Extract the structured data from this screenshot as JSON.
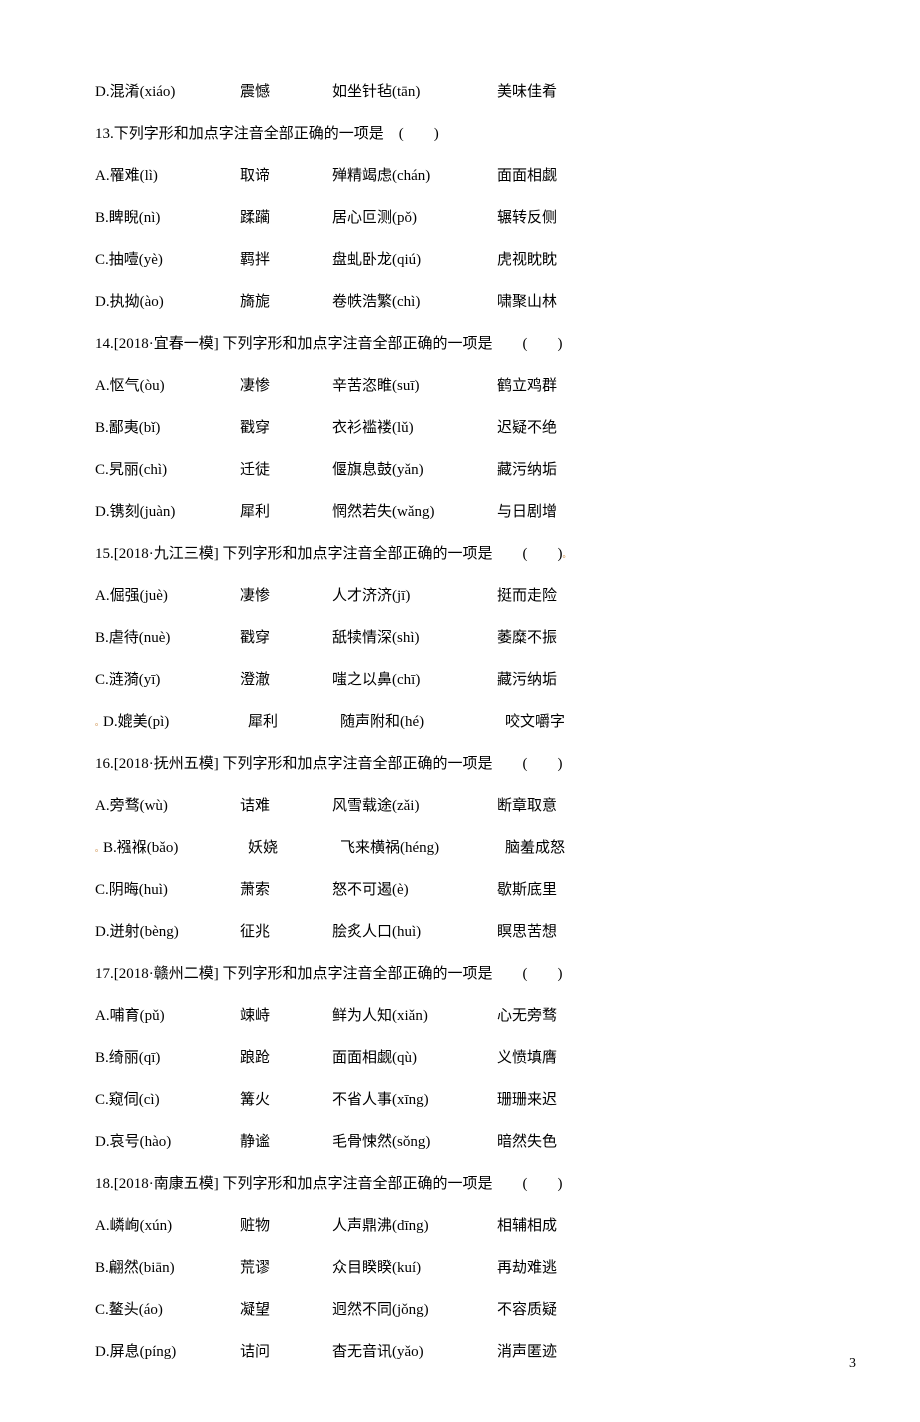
{
  "rows": [
    {
      "type": "opt",
      "a": "D.混淆(xiáo)",
      "b": "震憾",
      "c": "如坐针毡(tān)",
      "d": "美味佳肴"
    },
    {
      "type": "q",
      "text": "13.下列字形和加点字注音全部正确的一项是　(　　)"
    },
    {
      "type": "opt",
      "a": "A.罹难(lì)",
      "b": "取谛",
      "c": "殚精竭虑(chán)",
      "d": "面面相觑"
    },
    {
      "type": "opt",
      "a": "B.睥睨(nì)",
      "b": "蹂躏",
      "c": "居心叵测(pǒ)",
      "d": "辗转反侧"
    },
    {
      "type": "opt",
      "a": "C.抽噎(yè)",
      "b": "羁拌",
      "c": "盘虬卧龙(qiú)",
      "d": "虎视眈眈"
    },
    {
      "type": "opt",
      "a": "D.执拗(ào)",
      "b": "旖旎",
      "c": "卷帙浩繁(chì)",
      "d": "啸聚山林"
    },
    {
      "type": "q",
      "text": "14.[2018·宜春一模] 下列字形和加点字注音全部正确的一项是　　(　　)"
    },
    {
      "type": "opt",
      "a": "A.怄气(òu)",
      "b": "凄惨",
      "c": "辛苦恣睢(suī)",
      "d": "鹤立鸡群"
    },
    {
      "type": "opt",
      "a": "B.鄙夷(bǐ)",
      "b": "戳穿",
      "c": "衣衫褴褛(lǔ)",
      "d": "迟疑不绝"
    },
    {
      "type": "opt",
      "a": "C.旯丽(chì)",
      "b": "迁徒",
      "c": "偃旗息鼓(yǎn)",
      "d": "藏污纳垢",
      "orange_in_c": true
    },
    {
      "type": "opt",
      "a": "D.镌刻(juàn)",
      "b": "犀利",
      "c": "惘然若失(wǎng)",
      "d": "与日剧增"
    },
    {
      "type": "q",
      "text": "15.[2018·九江三模] 下列字形和加点字注音全部正确的一项是　　(　　)",
      "orange_after": true
    },
    {
      "type": "opt",
      "a": "A.倔强(juè)",
      "b": "凄惨",
      "c": "人才济济(jī)",
      "d": "挺而走险"
    },
    {
      "type": "opt",
      "a": "B.虐待(nuè)",
      "b": "戳穿",
      "c": "舐犊情深(shì)",
      "d": "萎糜不振"
    },
    {
      "type": "opt",
      "a": "C.涟漪(yī)",
      "b": "澄澈",
      "c": "嗤之以鼻(chī)",
      "d": "藏污纳垢"
    },
    {
      "type": "opt",
      "a": "D.媲美(pì)",
      "b": "犀利",
      "c": "随声附和(hé)",
      "d": "咬文嚼字",
      "orange_before_a": true
    },
    {
      "type": "q",
      "text": "16.[2018·抚州五模] 下列字形和加点字注音全部正确的一项是　　(　　)"
    },
    {
      "type": "opt",
      "a": "A.旁骛(wù)",
      "b": "诘难",
      "c": "风雪载途(zǎi)",
      "d": "断章取意"
    },
    {
      "type": "opt",
      "a": "B.襁褓(bǎo)",
      "b": "妖娆",
      "c": "飞来横祸(héng)",
      "d": "脑羞成怒",
      "orange_before_a": true
    },
    {
      "type": "opt",
      "a": "C.阴晦(huì)",
      "b": "萧索",
      "c": "怒不可遏(è)",
      "d": "歇斯底里"
    },
    {
      "type": "opt",
      "a": "D.迸射(bèng)",
      "b": "征兆",
      "c": "脍炙人口(huì)",
      "d": "瞑思苦想"
    },
    {
      "type": "q",
      "text": "17.[2018·赣州二模] 下列字形和加点字注音全部正确的一项是　　(　　)"
    },
    {
      "type": "opt",
      "a": "A.哺育(pǔ)",
      "b": "竦峙",
      "c": "鲜为人知(xiǎn)",
      "d": "心无旁骛"
    },
    {
      "type": "opt",
      "a": "B.绮丽(qī)",
      "b": "踉跄",
      "c": "面面相觑(qù)",
      "d": "义愤填膺"
    },
    {
      "type": "opt",
      "a": "C.窥伺(cì)",
      "b": "篝火",
      "c": "不省人事(xīng)",
      "d": "珊珊来迟"
    },
    {
      "type": "opt",
      "a": "D.哀号(hào)",
      "b": "静谧",
      "c": "毛骨悚然(sǒng)",
      "d": "暗然失色"
    },
    {
      "type": "q",
      "text": "18.[2018·南康五模] 下列字形和加点字注音全部正确的一项是　　(　　)"
    },
    {
      "type": "opt",
      "a": "A.嶙峋(xún)",
      "b": "赃物",
      "c": "人声鼎沸(dīng)",
      "d": "相辅相成"
    },
    {
      "type": "opt",
      "a": "B.翩然(biān)",
      "b": "荒谬",
      "c": "众目睽睽(kuí)",
      "d": "再劫难逃"
    },
    {
      "type": "opt",
      "a": "C.鳌头(áo)",
      "b": "凝望",
      "c": "迥然不同(jǒng)",
      "d": "不容质疑"
    },
    {
      "type": "opt",
      "a": "D.屏息(píng)",
      "b": "诘问",
      "c": "杳无音讯(yǎo)",
      "d": "消声匿迹"
    }
  ],
  "pagenum": "3"
}
